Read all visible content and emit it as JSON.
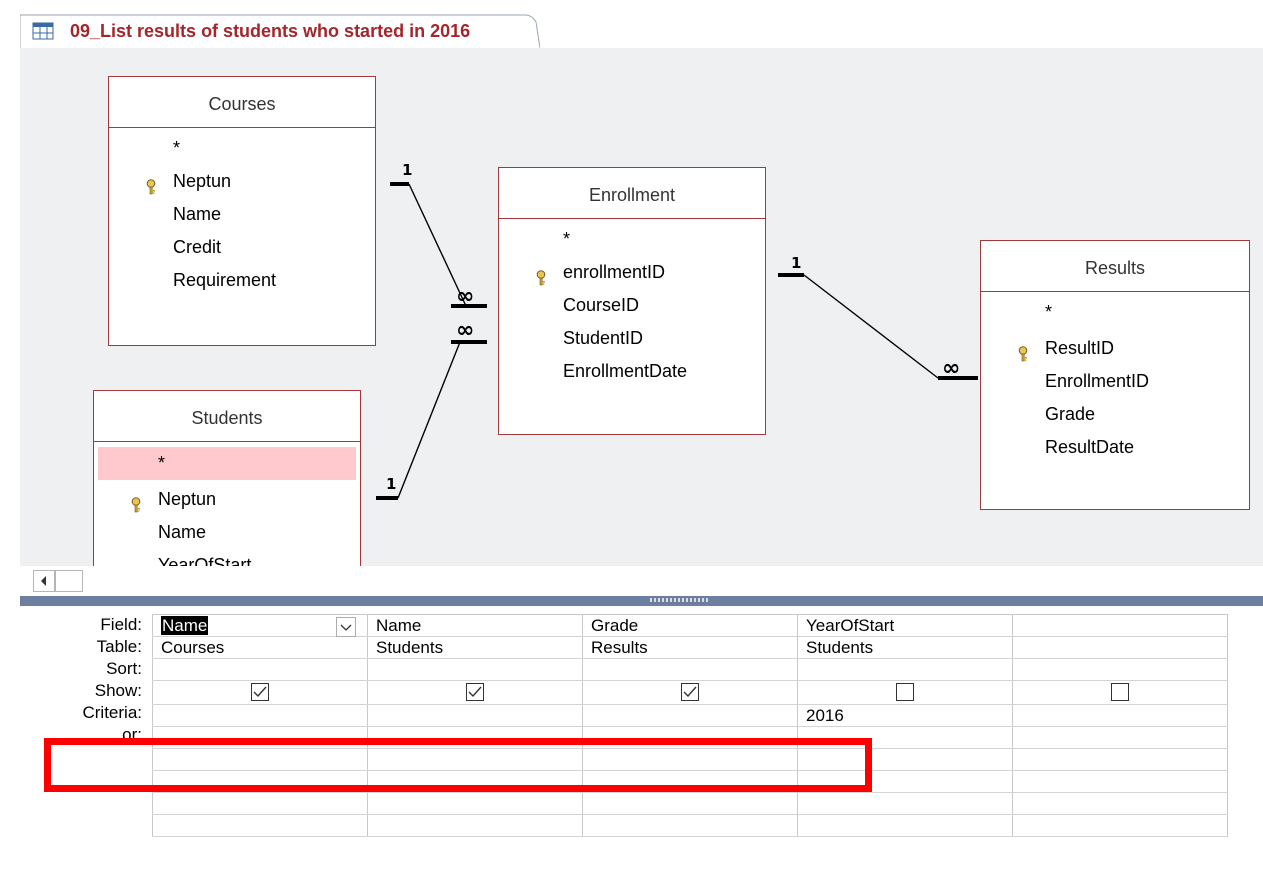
{
  "tab": {
    "title": "09_List results of students who started in 2016",
    "icon": "query-icon"
  },
  "tables": {
    "courses": {
      "title": "Courses",
      "fields": [
        "*",
        "Neptun",
        "Name",
        "Credit",
        "Requirement"
      ],
      "key_field": "Neptun"
    },
    "students": {
      "title": "Students",
      "fields": [
        "*",
        "Neptun",
        "Name",
        "YearOfStart"
      ],
      "key_field": "Neptun"
    },
    "enrollment": {
      "title": "Enrollment",
      "fields": [
        "*",
        "enrollmentID",
        "CourseID",
        "StudentID",
        "EnrollmentDate"
      ],
      "key_field": "enrollmentID"
    },
    "results": {
      "title": "Results",
      "fields": [
        "*",
        "ResultID",
        "EnrollmentID",
        "Grade",
        "ResultDate"
      ],
      "key_field": "ResultID"
    }
  },
  "relationships": [
    {
      "one": "1",
      "many": "∞"
    },
    {
      "one": "1",
      "many": "∞"
    },
    {
      "one": "1",
      "many": "∞"
    }
  ],
  "grid": {
    "row_labels": [
      "Field:",
      "Table:",
      "Sort:",
      "Show:",
      "Criteria:",
      "or:"
    ],
    "columns": [
      {
        "field": "Name",
        "table": "Courses",
        "sort": "",
        "show": true,
        "criteria": ""
      },
      {
        "field": "Name",
        "table": "Students",
        "sort": "",
        "show": true,
        "criteria": ""
      },
      {
        "field": "Grade",
        "table": "Results",
        "sort": "",
        "show": true,
        "criteria": ""
      },
      {
        "field": "YearOfStart",
        "table": "Students",
        "sort": "",
        "show": false,
        "criteria": "2016"
      },
      {
        "field": "",
        "table": "",
        "sort": "",
        "show": false,
        "criteria": ""
      }
    ]
  },
  "colors": {
    "accent": "#a4262c",
    "canvas": "#eef0f2",
    "highlight": "#ff0000",
    "row_highlight": "#ffc9cd"
  }
}
